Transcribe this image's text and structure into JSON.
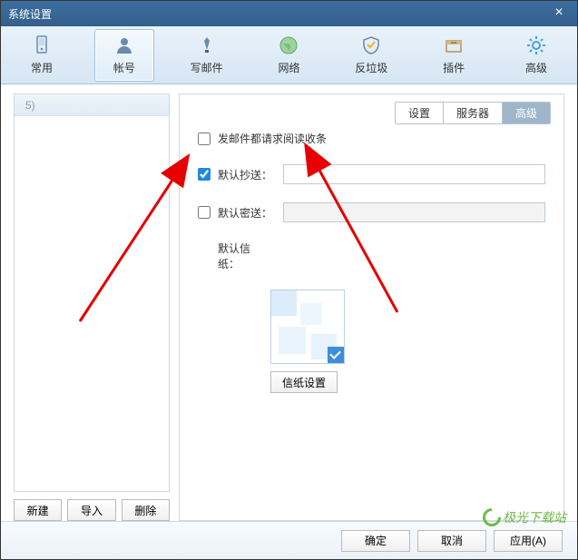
{
  "window": {
    "title": "系统设置"
  },
  "tabs": [
    {
      "label": "常用"
    },
    {
      "label": "帐号"
    },
    {
      "label": "写邮件"
    },
    {
      "label": "网络"
    },
    {
      "label": "反垃圾"
    },
    {
      "label": "插件"
    },
    {
      "label": "高级"
    }
  ],
  "activeTab": "帐号",
  "accountList": {
    "item0": "5)"
  },
  "leftButtons": {
    "new": "新建",
    "import": "导入",
    "delete": "删除"
  },
  "subtabs": {
    "settings": "设置",
    "server": "服务器",
    "advanced": "高级",
    "active": "高级"
  },
  "form": {
    "receipt": {
      "checked": false,
      "label": "发邮件都请求阅读收条"
    },
    "cc": {
      "checked": true,
      "label": "默认抄送：",
      "value": ""
    },
    "bcc": {
      "checked": false,
      "label": "默认密送：",
      "value": ""
    },
    "stationery": {
      "label": "默认信纸：",
      "button": "信纸设置"
    }
  },
  "footer": {
    "ok": "确定",
    "cancel": "取消",
    "apply": "应用(A)"
  },
  "watermark": "极光下载站"
}
